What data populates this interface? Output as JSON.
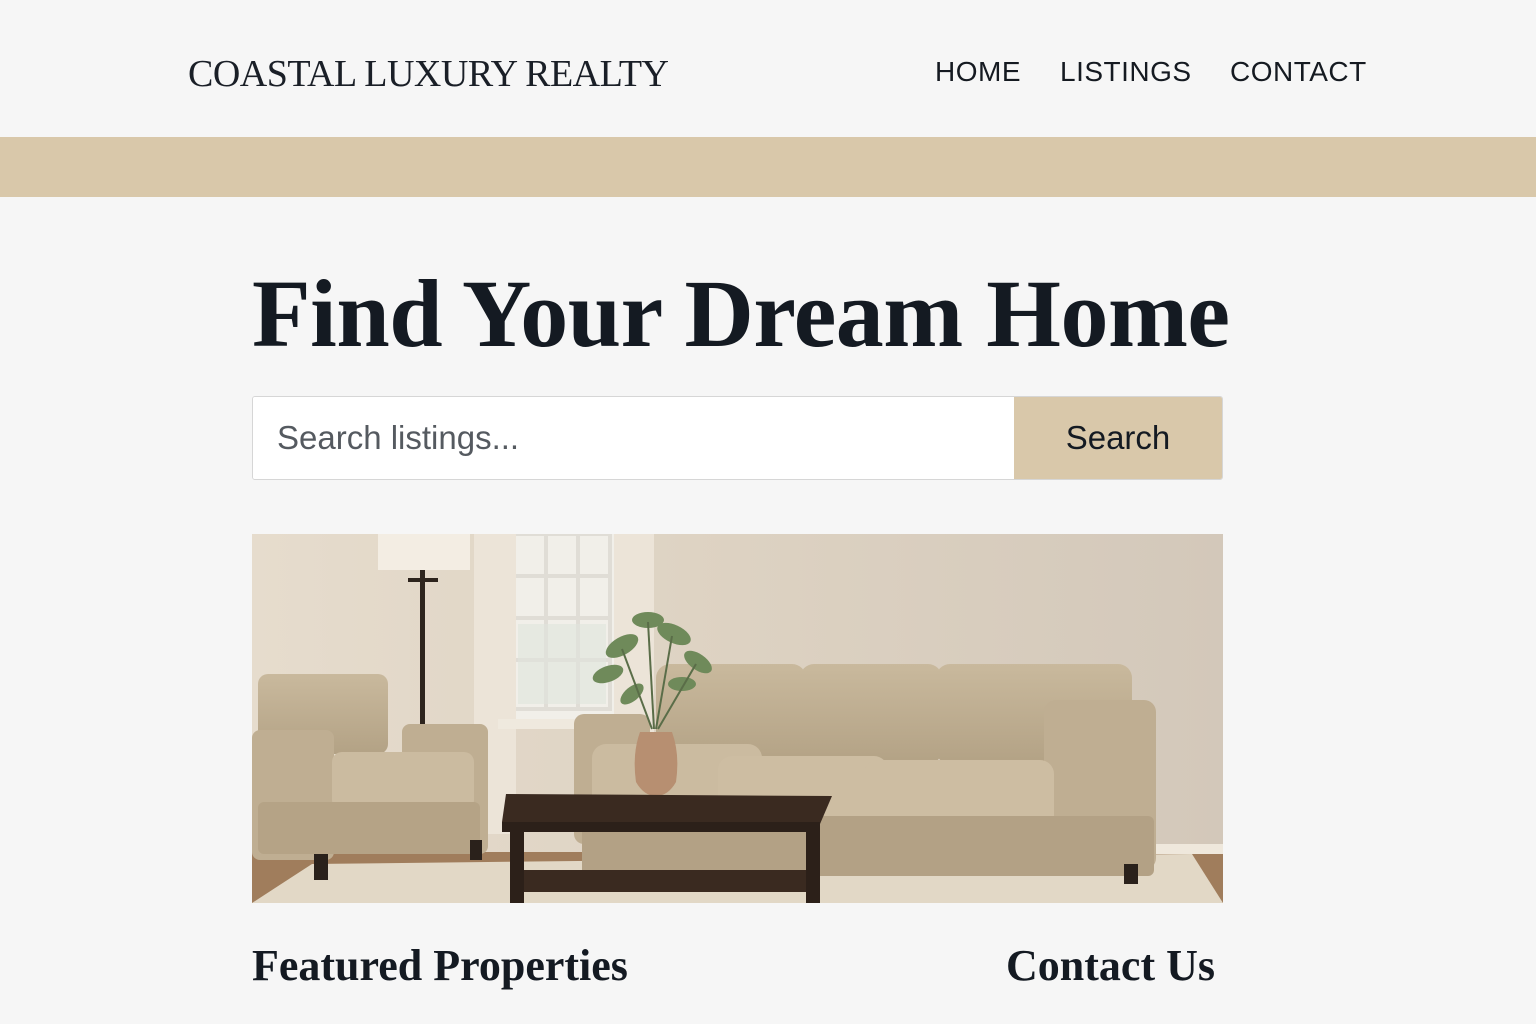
{
  "header": {
    "brand": "COASTAL LUXURY REALTY",
    "nav": [
      "HOME",
      "LISTINGS",
      "CONTACT"
    ]
  },
  "hero": {
    "title": "Find Your Dream Home",
    "search": {
      "placeholder": "Search listings...",
      "value": "",
      "button_label": "Search"
    },
    "image_alt": "Living room with beige sofa, armchair, floor lamp and dark wood coffee table"
  },
  "sections": {
    "featured": "Featured Properties",
    "contact": "Contact Us"
  },
  "colors": {
    "accent": "#d9c8aa",
    "background": "#f6f6f6",
    "text": "#141a22"
  }
}
